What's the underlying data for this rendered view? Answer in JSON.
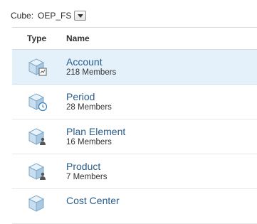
{
  "cube": {
    "label": "Cube:",
    "value": "OEP_FS"
  },
  "table": {
    "headers": {
      "type": "Type",
      "name": "Name"
    },
    "rows": [
      {
        "name": "Account",
        "members": "218 Members",
        "icon": "dimension-account-icon",
        "selected": true
      },
      {
        "name": "Period",
        "members": "28 Members",
        "icon": "dimension-time-icon",
        "selected": false
      },
      {
        "name": "Plan Element",
        "members": "16 Members",
        "icon": "dimension-generic-icon",
        "selected": false
      },
      {
        "name": "Product",
        "members": "7 Members",
        "icon": "dimension-generic-icon",
        "selected": false
      },
      {
        "name": "Cost Center",
        "members": "",
        "icon": "dimension-generic-icon",
        "selected": false
      }
    ]
  },
  "colors": {
    "selected_row": "#e4f1fb",
    "link_text": "#2a5c8a",
    "cube_fill": "#c9dff0"
  }
}
